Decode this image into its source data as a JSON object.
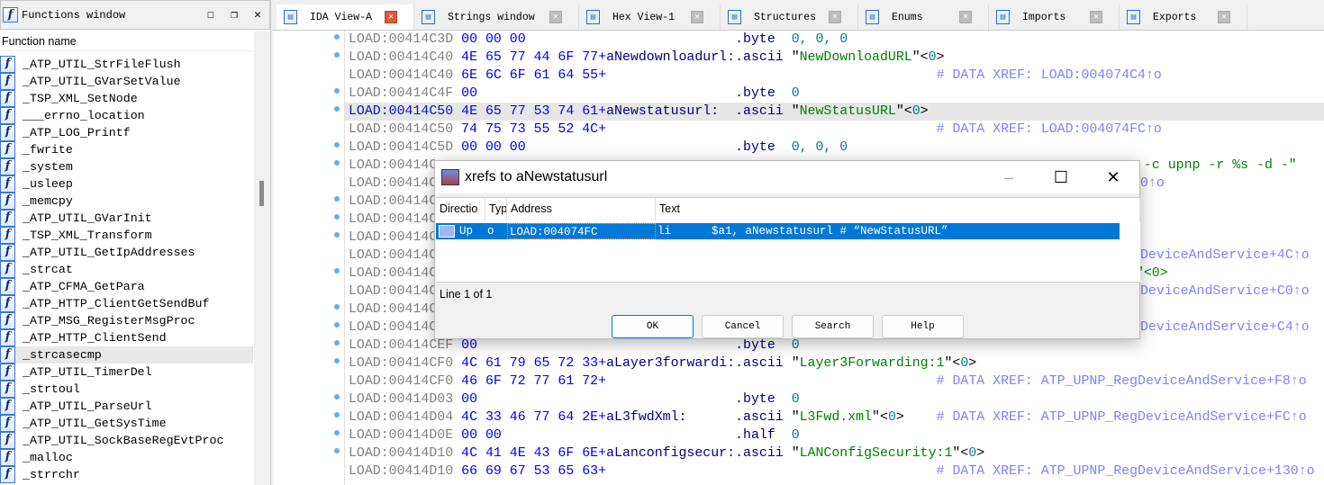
{
  "functions_window": {
    "title": "Functions window",
    "column": "Function name",
    "selected_index": 17,
    "items": [
      "_ATP_UTIL_StrFileFlush",
      "_ATP_UTIL_GVarSetValue",
      "_TSP_XML_SetNode",
      "___errno_location",
      "_ATP_LOG_Printf",
      "_fwrite",
      "_system",
      "_usleep",
      "_memcpy",
      "_ATP_UTIL_GVarInit",
      "_TSP_XML_Transform",
      "_ATP_UTIL_GetIpAddresses",
      "_strcat",
      "_ATP_CFMA_GetPara",
      "_ATP_HTTP_ClientGetSendBuf",
      "_ATP_MSG_RegisterMsgProc",
      "_ATP_HTTP_ClientSend",
      "_strcasecmp",
      "_ATP_UTIL_TimerDel",
      "_strtoul",
      "_ATP_UTIL_ParseUrl",
      "_ATP_UTIL_GetSysTime",
      "_ATP_UTIL_SockBaseRegEvtProc",
      "_malloc",
      "_strrchr"
    ]
  },
  "tabs": [
    {
      "label": "IDA View-A",
      "icon": "ida-view-icon",
      "active": true
    },
    {
      "label": "Strings window",
      "icon": "strings-icon"
    },
    {
      "label": "Hex View-1",
      "icon": "hex-icon"
    },
    {
      "label": "Structures",
      "icon": "structures-icon"
    },
    {
      "label": "Enums",
      "icon": "enums-icon"
    },
    {
      "label": "Imports",
      "icon": "imports-icon"
    },
    {
      "label": "Exports",
      "icon": "exports-icon"
    }
  ],
  "listing": [
    {
      "addr": "LOAD:00414C3D",
      "bytes": "00 00 00",
      "mn": ".byte",
      "num": "0, 0, 0",
      "dot": true
    },
    {
      "addr": "LOAD:00414C40",
      "bytes": "4E 65 77 44 6F 77+",
      "label": "aNewdownloadurl:",
      "mn": ".ascii",
      "str": "NewDownloadURL",
      "dot": true
    },
    {
      "addr": "LOAD:00414C40",
      "bytes": "6E 6C 6F 61 64 55+",
      "cmt": "# DATA XREF: LOAD:004074C4↑o"
    },
    {
      "addr": "LOAD:00414C4F",
      "bytes": "00",
      "mn": ".byte",
      "num": "0",
      "dot": true
    },
    {
      "addr": "LOAD:00414C50",
      "bytes": "4E 65 77 53 74 61+",
      "label": "aNewstatusurl:",
      "mn": ".ascii",
      "str": "NewStatusURL",
      "dot": true,
      "hl": true
    },
    {
      "addr": "LOAD:00414C50",
      "bytes": "74 75 73 55 52 4C+",
      "cmt": "# DATA XREF: LOAD:004074FC↑o"
    },
    {
      "addr": "LOAD:00414C5D",
      "bytes": "00 00 00",
      "mn": ".byte",
      "num": "0, 0, 0",
      "dot": true
    },
    {
      "addr": "LOAD:00414C",
      "tail": " -c upnp -r %s -d -\"",
      "dot": true
    },
    {
      "addr": "LOAD:00414C",
      "tail": "0↑o",
      "tailcmt": true
    },
    {
      "addr": "LOAD:00414C",
      "dot": true
    },
    {
      "addr": "LOAD:00414C",
      "dot": true
    },
    {
      "addr": "LOAD:00414C",
      "dot": true
    },
    {
      "addr": "LOAD:00414C",
      "tail": "DeviceAndService+4C↑o",
      "tailcmt": true
    },
    {
      "addr": "LOAD:00414C",
      "tail": "\"<0>",
      "dot": true
    },
    {
      "addr": "LOAD:00414C",
      "tail": "DeviceAndService+C0↑o",
      "tailcmt": true
    },
    {
      "addr": "LOAD:00414C",
      "dot": true
    },
    {
      "addr": "LOAD:00414C",
      "tail": "DeviceAndService+C4↑o",
      "tailcmt": true,
      "dot": true
    },
    {
      "addr": "LOAD:00414CEF",
      "bytes": "00",
      "mn": ".byte",
      "num": "0",
      "dot": true
    },
    {
      "addr": "LOAD:00414CF0",
      "bytes": "4C 61 79 65 72 33+",
      "label": "aLayer3forwardi:",
      "mn": ".ascii",
      "str": "Layer3Forwarding:1",
      "dot": true
    },
    {
      "addr": "LOAD:00414CF0",
      "bytes": "46 6F 72 77 61 72+",
      "cmt": "# DATA XREF: ATP_UPNP_RegDeviceAndService+F8↑o"
    },
    {
      "addr": "LOAD:00414D03",
      "bytes": "00",
      "mn": ".byte",
      "num": "0",
      "dot": true
    },
    {
      "addr": "LOAD:00414D04",
      "bytes": "4C 33 46 77 64 2E+",
      "label": "aL3fwdXml:",
      "mn": ".ascii",
      "str": "L3Fwd.xml",
      "cmt": "# DATA XREF: ATP_UPNP_RegDeviceAndService+FC↑o",
      "dot": true
    },
    {
      "addr": "LOAD:00414D0E",
      "bytes": "00 00",
      "mn": ".half",
      "num": "0",
      "dot": true
    },
    {
      "addr": "LOAD:00414D10",
      "bytes": "4C 41 4E 43 6F 6E+",
      "label": "aLanconfigsecur:",
      "mn": ".ascii",
      "str": "LANConfigSecurity:1",
      "dot": true
    },
    {
      "addr": "LOAD:00414D10",
      "bytes": "66 69 67 53 65 63+",
      "cmt": "# DATA XREF: ATP_UPNP_RegDeviceAndService+130↑o"
    }
  ],
  "dialog": {
    "title": "xrefs to aNewstatusurl",
    "columns": [
      "Directio",
      "Typ",
      "Address",
      "Text"
    ],
    "row": {
      "direction": "Up",
      "type": "o",
      "address": "LOAD:004074FC",
      "text": "li      $a1, aNewstatusurl # “NewStatusURL”"
    },
    "status": "Line 1 of 1",
    "buttons": {
      "ok": "OK",
      "cancel": "Cancel",
      "search": "Search",
      "help": "Help"
    }
  },
  "colors": {
    "selection": "#0078d7",
    "string": "#008000",
    "comment": "#8080ff",
    "bytes": "#0000ee"
  }
}
